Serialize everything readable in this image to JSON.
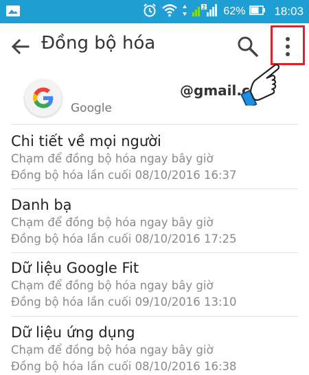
{
  "status_bar": {
    "battery_percent": "62%",
    "time": "18:03",
    "network_badge": "2",
    "icons": [
      "image-icon",
      "alarm-icon",
      "wifi-icon",
      "signal-icon",
      "battery-icon"
    ]
  },
  "toolbar": {
    "title": "Đồng bộ hóa",
    "icons": [
      "back-arrow-icon",
      "search-icon",
      "more-vert-icon"
    ]
  },
  "account": {
    "email": "@gmail.c",
    "type": "Google",
    "icons": [
      "google-logo"
    ]
  },
  "sync_items": [
    {
      "title": "Chi tiết về mọi người",
      "action": "Chạm để đồng bộ hóa ngay bây giờ",
      "last_sync": "Đồng bộ hóa lần cuối 08/10/2016 16:37"
    },
    {
      "title": "Danh bạ",
      "action": "Chạm để đồng bộ hóa ngay bây giờ",
      "last_sync": "Đồng bộ hóa lần cuối 08/10/2016 17:25"
    },
    {
      "title": "Dữ liệu Google Fit",
      "action": "Chạm để đồng bộ hóa ngay bây giờ",
      "last_sync": "Đồng bộ hóa lần cuối 09/10/2016 13:10"
    },
    {
      "title": "Dữ liệu ứng dụng",
      "action": "Chạm để đồng bộ hóa ngay bây giờ",
      "last_sync": "Đồng bộ hóa lần cuối 08/10/2016 16:38"
    }
  ],
  "colors": {
    "status_bar": "#1f9fd3",
    "highlight_box": "#e0202a",
    "title_text": "#333333",
    "secondary_text": "#8a8a8a"
  }
}
